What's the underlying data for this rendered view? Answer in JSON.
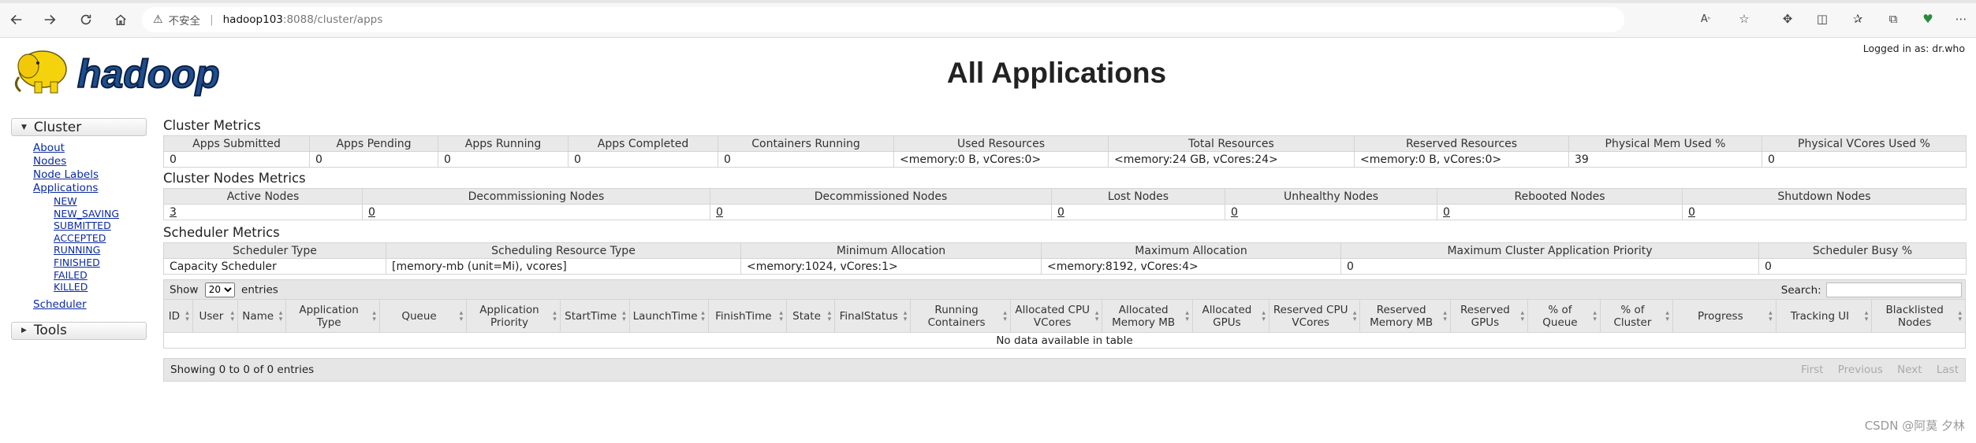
{
  "browser": {
    "insecure_label": "不安全",
    "url_host": "hadoop103",
    "url_rest": ":8088/cluster/apps"
  },
  "header": {
    "title": "All Applications",
    "logged_in": "Logged in as: dr.who",
    "logo_text": "hadoop"
  },
  "sidebar": {
    "cluster_label": "Cluster",
    "links": [
      "About",
      "Nodes",
      "Node Labels",
      "Applications"
    ],
    "app_states": [
      "NEW",
      "NEW_SAVING",
      "SUBMITTED",
      "ACCEPTED",
      "RUNNING",
      "FINISHED",
      "FAILED",
      "KILLED"
    ],
    "scheduler_label": "Scheduler",
    "tools_label": "Tools"
  },
  "cluster_metrics": {
    "title": "Cluster Metrics",
    "headers": [
      "Apps Submitted",
      "Apps Pending",
      "Apps Running",
      "Apps Completed",
      "Containers Running",
      "Used Resources",
      "Total Resources",
      "Reserved Resources",
      "Physical Mem Used %",
      "Physical VCores Used %"
    ],
    "values": [
      "0",
      "0",
      "0",
      "0",
      "0",
      "<memory:0 B, vCores:0>",
      "<memory:24 GB, vCores:24>",
      "<memory:0 B, vCores:0>",
      "39",
      "0"
    ]
  },
  "node_metrics": {
    "title": "Cluster Nodes Metrics",
    "headers": [
      "Active Nodes",
      "Decommissioning Nodes",
      "Decommissioned Nodes",
      "Lost Nodes",
      "Unhealthy Nodes",
      "Rebooted Nodes",
      "Shutdown Nodes"
    ],
    "values": [
      "3",
      "0",
      "0",
      "0",
      "0",
      "0",
      "0"
    ]
  },
  "scheduler_metrics": {
    "title": "Scheduler Metrics",
    "headers": [
      "Scheduler Type",
      "Scheduling Resource Type",
      "Minimum Allocation",
      "Maximum Allocation",
      "Maximum Cluster Application Priority",
      "Scheduler Busy %"
    ],
    "values": [
      "Capacity Scheduler",
      "[memory-mb (unit=Mi), vcores]",
      "<memory:1024, vCores:1>",
      "<memory:8192, vCores:4>",
      "0",
      "0"
    ]
  },
  "apps_table": {
    "show_label": "Show",
    "entries_label": "entries",
    "page_size": "20",
    "search_label": "Search:",
    "columns": [
      "ID",
      "User",
      "Name",
      "Application Type",
      "Queue",
      "Application Priority",
      "StartTime",
      "LaunchTime",
      "FinishTime",
      "State",
      "FinalStatus",
      "Running Containers",
      "Allocated CPU VCores",
      "Allocated Memory MB",
      "Allocated GPUs",
      "Reserved CPU VCores",
      "Reserved Memory MB",
      "Reserved GPUs",
      "% of Queue",
      "% of Cluster",
      "Progress",
      "Tracking UI",
      "Blacklisted Nodes"
    ],
    "empty_message": "No data available in table",
    "info": "Showing 0 to 0 of 0 entries",
    "pager": [
      "First",
      "Previous",
      "Next",
      "Last"
    ]
  },
  "watermark": "CSDN @阿莫 夕林"
}
